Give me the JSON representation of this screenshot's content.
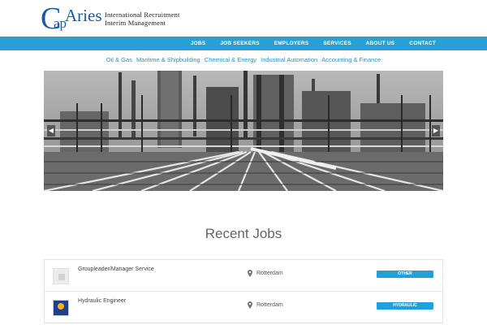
{
  "brand": {
    "logo_c": "C",
    "logo_ap": "ap",
    "logo_aries": "Aries",
    "tagline_line1": "International Recruitment",
    "tagline_line2": "Interim Management",
    "color": "#1a5aa0"
  },
  "nav": {
    "items": [
      {
        "label": "JOBS"
      },
      {
        "label": "JOB SEEKERS"
      },
      {
        "label": "EMPLOYERS"
      },
      {
        "label": "SERVICES"
      },
      {
        "label": "ABOUT US"
      },
      {
        "label": "CONTACT"
      }
    ],
    "bar_color": "#27a0d5"
  },
  "sectors": [
    {
      "label": "Oil & Gas"
    },
    {
      "label": "Maritime & Shipbuilding"
    },
    {
      "label": "Chemical & Energy"
    },
    {
      "label": "Industrial Automation"
    },
    {
      "label": "Accounting & Finance"
    }
  ],
  "slider": {
    "image": "industrial-plant-photo",
    "prev_icon": "chevron-left-icon",
    "next_icon": "chevron-right-icon"
  },
  "recent_jobs": {
    "title": "Recent Jobs",
    "jobs": [
      {
        "title": "Groupleader/Manager Service",
        "location": "Rotterdam",
        "tag": "OTHER",
        "logo": "placeholder-building-icon"
      },
      {
        "title": "Hydraulic Engineer",
        "location": "Rotterdam",
        "tag": "HYDRAULIC",
        "logo": "company-logo"
      }
    ],
    "tag_color": "#1fa0d9"
  }
}
